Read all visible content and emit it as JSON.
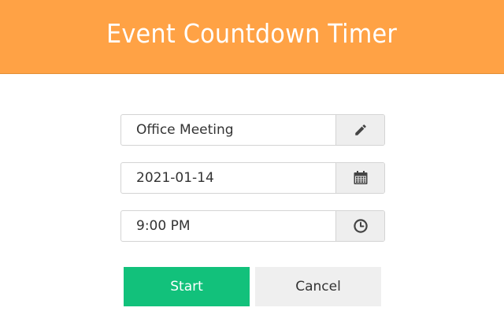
{
  "header": {
    "title": "Event Countdown Timer"
  },
  "form": {
    "event_name": {
      "value": "Office Meeting",
      "icon": "pencil-icon"
    },
    "event_date": {
      "value": "2021-01-14",
      "icon": "calendar-icon"
    },
    "event_time": {
      "value": "9:00 PM",
      "icon": "clock-icon"
    }
  },
  "actions": {
    "start_label": "Start",
    "cancel_label": "Cancel"
  },
  "colors": {
    "header_bg": "#ffa245",
    "start_bg": "#12c17b",
    "cancel_bg": "#efefef",
    "addon_bg": "#eeeeee"
  }
}
